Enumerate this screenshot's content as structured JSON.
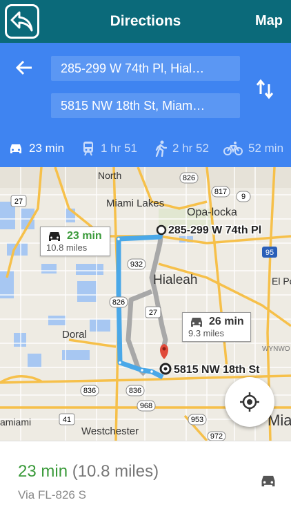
{
  "header": {
    "title": "Directions",
    "map_label": "Map"
  },
  "route_inputs": {
    "origin": "285-299 W 74th Pl, Hial…",
    "destination": "5815 NW 18th St, Miam…"
  },
  "modes": [
    {
      "name": "car-icon",
      "time": "23 min",
      "active": true
    },
    {
      "name": "train-icon",
      "time": "1 hr 51",
      "active": false
    },
    {
      "name": "walk-icon",
      "time": "2 hr 52",
      "active": false
    },
    {
      "name": "bike-icon",
      "time": "52 min",
      "active": false
    }
  ],
  "map": {
    "places": {
      "north": "North",
      "miami_lakes": "Miami Lakes",
      "opa_locka": "Opa-locka",
      "hialeah": "Hialeah",
      "doral": "Doral",
      "el_po": "El Po",
      "westchester": "Westchester",
      "tamiami": "amiami",
      "mia": "Mia",
      "wynwood": "WYNWO"
    },
    "shields": {
      "r826a": "826",
      "r817": "817",
      "r9": "9",
      "r27a": "27",
      "r95": "95",
      "r932": "932",
      "r27b": "27",
      "r826b": "826",
      "r836a": "836",
      "r836b": "836",
      "r968": "968",
      "r41": "41",
      "r953": "953",
      "r972": "972"
    },
    "origin_label": "285-299 W 74th Pl",
    "destination_label": "5815 NW 18th St",
    "callout_primary": {
      "time": "23 min",
      "distance": "10.8 miles"
    },
    "callout_alt": {
      "time": "26 min",
      "distance": "9.3 miles"
    }
  },
  "summary": {
    "time": "23 min",
    "distance": "(10.8 miles)",
    "via": "Via FL-826 S"
  },
  "colors": {
    "header": "#0b6a7a",
    "panel": "#3f84f1",
    "route": "#4aa8e8",
    "alt_route": "#a8a8a8",
    "green": "#3a9a3a"
  }
}
